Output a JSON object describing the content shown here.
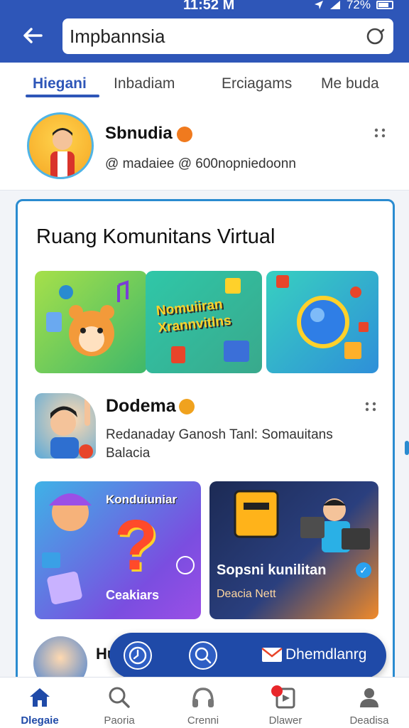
{
  "status": {
    "time": "11:52 M",
    "battery": "72%"
  },
  "header": {
    "search_value": "Impbannsia"
  },
  "tabs": [
    {
      "label": "Hiegani"
    },
    {
      "label": "Inbadiam"
    },
    {
      "label": "Erciagams"
    },
    {
      "label": "Me buda"
    }
  ],
  "profile": {
    "name": "Sbnudia",
    "handle": "@ madaiee @ 600nopniedoonn"
  },
  "card": {
    "title": "Ruang Komunitans Virtual",
    "tile2_text": "Nomuiiran Xrannvitlns"
  },
  "post": {
    "name": "Dodema",
    "description": "Redanaday Ganosh Tanl: Somauitans Balacia"
  },
  "tiles": {
    "t4_title": "Konduiuniar",
    "t4_sub": "Ceakiars",
    "t5_title": "Sopsni kunilitan",
    "t5_sub": "Deacia Nett"
  },
  "peek": {
    "name": "Hu"
  },
  "pill": {
    "label": "Dhemdlanrg"
  },
  "nav": [
    {
      "label": "Dlegaie"
    },
    {
      "label": "Paoria"
    },
    {
      "label": "Crenni"
    },
    {
      "label": "Dlawer"
    },
    {
      "label": "Deadisa"
    }
  ],
  "colors": {
    "primary": "#2e56b8",
    "accent": "#2a8bd0",
    "badge": "#f07a1e"
  }
}
